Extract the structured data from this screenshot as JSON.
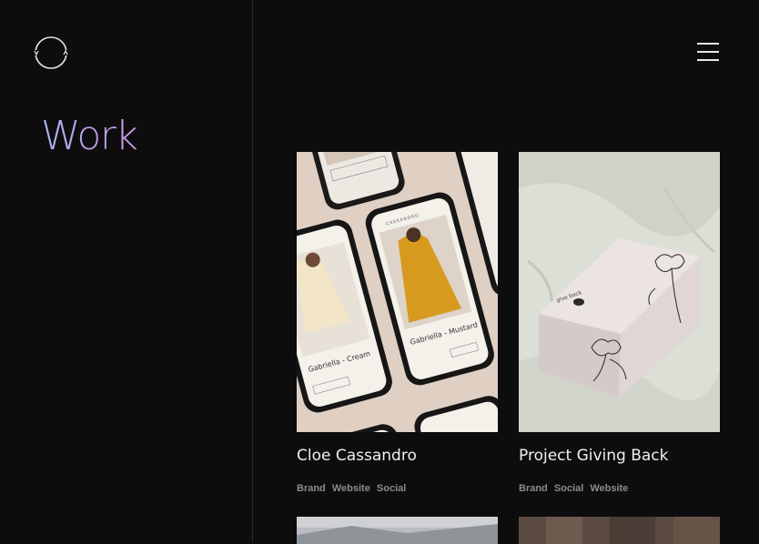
{
  "page": {
    "title": "Work"
  },
  "nav": {
    "menu_icon": "hamburger-icon",
    "logo_icon": "circle-logo-icon"
  },
  "projects": [
    {
      "title": "Cloe Cassandro",
      "tags": [
        "Brand",
        "Website",
        "Social"
      ],
      "mockup": {
        "brand": "CASSANDRO",
        "product_1": "Gabriella - Cream",
        "product_2": "Gabriella - Mustard"
      }
    },
    {
      "title": "Project Giving Back",
      "tags": [
        "Brand",
        "Social",
        "Website"
      ],
      "mockup": {
        "box_brand": "give back"
      }
    }
  ],
  "colors": {
    "background": "#0d0d0e",
    "title_gradient_start": "#a9b7f5",
    "title_gradient_end": "#d7a0ef",
    "tag_text": "#8b8b8b"
  }
}
